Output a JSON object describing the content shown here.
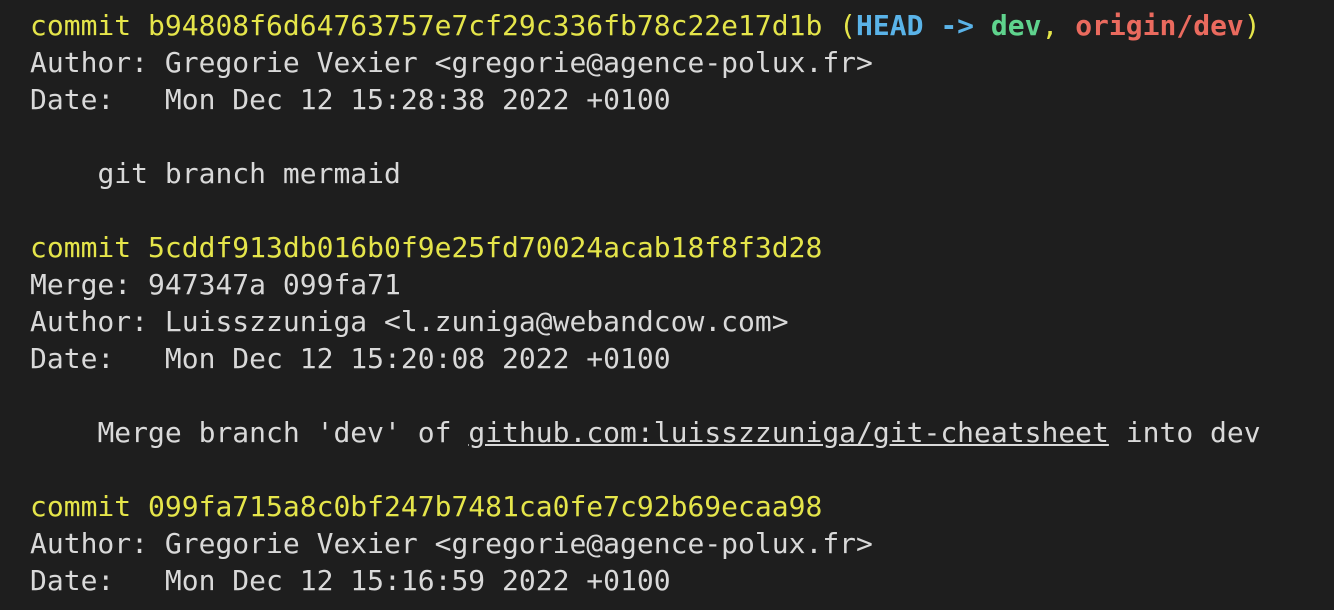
{
  "commits": [
    {
      "commit_label": "commit",
      "hash": "b94808f6d64763757e7cf29c336fb78c22e17d1b",
      "refs": {
        "open": "(",
        "head": "HEAD",
        "arrow": "->",
        "local_branch": "dev",
        "sep": ",",
        "remote_branch": "origin/dev",
        "close": ")"
      },
      "author_label": "Author:",
      "author": "Gregorie Vexier <gregorie@agence-polux.fr>",
      "date_label": "Date:",
      "date": "Mon Dec 12 15:28:38 2022 +0100",
      "message": "git branch mermaid"
    },
    {
      "commit_label": "commit",
      "hash": "5cddf913db016b0f9e25fd70024acab18f8f3d28",
      "merge_label": "Merge:",
      "merge": "947347a 099fa71",
      "author_label": "Author:",
      "author": "Luisszzuniga <l.zuniga@webandcow.com>",
      "date_label": "Date:",
      "date": "Mon Dec 12 15:20:08 2022 +0100",
      "message_pre": "Merge branch 'dev' of ",
      "message_link": "github.com:luisszzuniga/git-cheatsheet",
      "message_post": " into dev"
    },
    {
      "commit_label": "commit",
      "hash": "099fa715a8c0bf247b7481ca0fe7c92b69ecaa98",
      "author_label": "Author:",
      "author": "Gregorie Vexier <gregorie@agence-polux.fr>",
      "date_label": "Date:",
      "date": "Mon Dec 12 15:16:59 2022 +0100"
    }
  ],
  "colors": {
    "background": "#1e1e1e",
    "text": "#d9d9d9",
    "commit_yellow": "#e5e54a",
    "head_blue": "#5ab3e8",
    "local_branch_green": "#5fd38d",
    "remote_branch_red": "#ea6a5e"
  }
}
